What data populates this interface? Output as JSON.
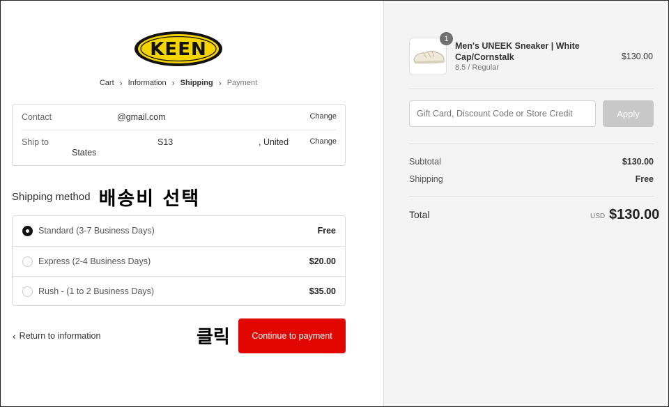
{
  "brand": {
    "logo_text": "KEEN"
  },
  "breadcrumb": {
    "items": [
      {
        "label": "Cart",
        "state": "link"
      },
      {
        "label": "Information",
        "state": "link"
      },
      {
        "label": "Shipping",
        "state": "active"
      },
      {
        "label": "Payment",
        "state": "inactive"
      }
    ],
    "separator_icon": "chevron-right-icon"
  },
  "review": {
    "contact": {
      "label": "Contact",
      "value": "@gmail.com",
      "change": "Change"
    },
    "ship_to": {
      "label": "Ship to",
      "value_a": "S13",
      "value_b": ", United",
      "value_c": "States",
      "change": "Change"
    }
  },
  "shipping": {
    "title": "Shipping method",
    "annotation": "배송비 선택",
    "methods": [
      {
        "label": "Standard (3-7 Business Days)",
        "price": "Free",
        "selected": true
      },
      {
        "label": "Express (2-4 Business Days)",
        "price": "$20.00",
        "selected": false
      },
      {
        "label": "Rush - (1 to 2 Business Days)",
        "price": "$35.00",
        "selected": false
      }
    ]
  },
  "actions": {
    "return_label": "Return to information",
    "click_annotation": "클릭",
    "continue_label": "Continue to payment"
  },
  "colors": {
    "primary_button": "#e10600",
    "summary_bg": "#f4f4f4",
    "logo_yellow": "#f5d400"
  },
  "summary": {
    "product": {
      "quantity": "1",
      "name": "Men's UNEEK Sneaker | White Cap/Cornstalk",
      "variant": "8.5 / Regular",
      "price": "$130.00"
    },
    "discount": {
      "placeholder": "Gift Card, Discount Code or Store Credit",
      "apply_label": "Apply"
    },
    "subtotal": {
      "label": "Subtotal",
      "value": "$130.00"
    },
    "shipping": {
      "label": "Shipping",
      "value": "Free"
    },
    "total": {
      "label": "Total",
      "currency": "USD",
      "value": "$130.00"
    }
  }
}
